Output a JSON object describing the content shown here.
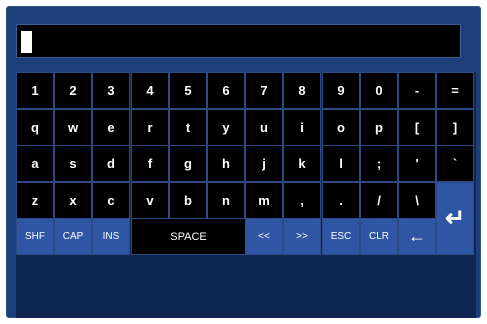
{
  "keyboard": {
    "rows": [
      [
        "1",
        "2",
        "3",
        "4",
        "5",
        "6",
        "7",
        "8",
        "9",
        "0",
        "-",
        "="
      ],
      [
        "q",
        "w",
        "e",
        "r",
        "t",
        "y",
        "u",
        "i",
        "o",
        "p",
        "[",
        "]"
      ],
      [
        "a",
        "s",
        "d",
        "f",
        "g",
        "h",
        "j",
        "k",
        "l",
        ";",
        "'",
        "`"
      ],
      [
        "z",
        "x",
        "c",
        "v",
        "b",
        "n",
        "m",
        ",",
        ".",
        "/",
        "\\"
      ]
    ],
    "function_keys": {
      "shift": "SHF",
      "caps": "CAP",
      "insert": "INS",
      "space": "SPACE",
      "move_left": "<<",
      "move_right": ">>",
      "escape": "ESC",
      "clear": "CLR"
    },
    "icons": {
      "backspace": "backspace-arrow-icon",
      "enter": "enter-return-icon"
    },
    "colors": {
      "frame": "#1d3e78",
      "key": "#000000",
      "function_key": "#2e56a4",
      "text": "#ffffff"
    }
  }
}
